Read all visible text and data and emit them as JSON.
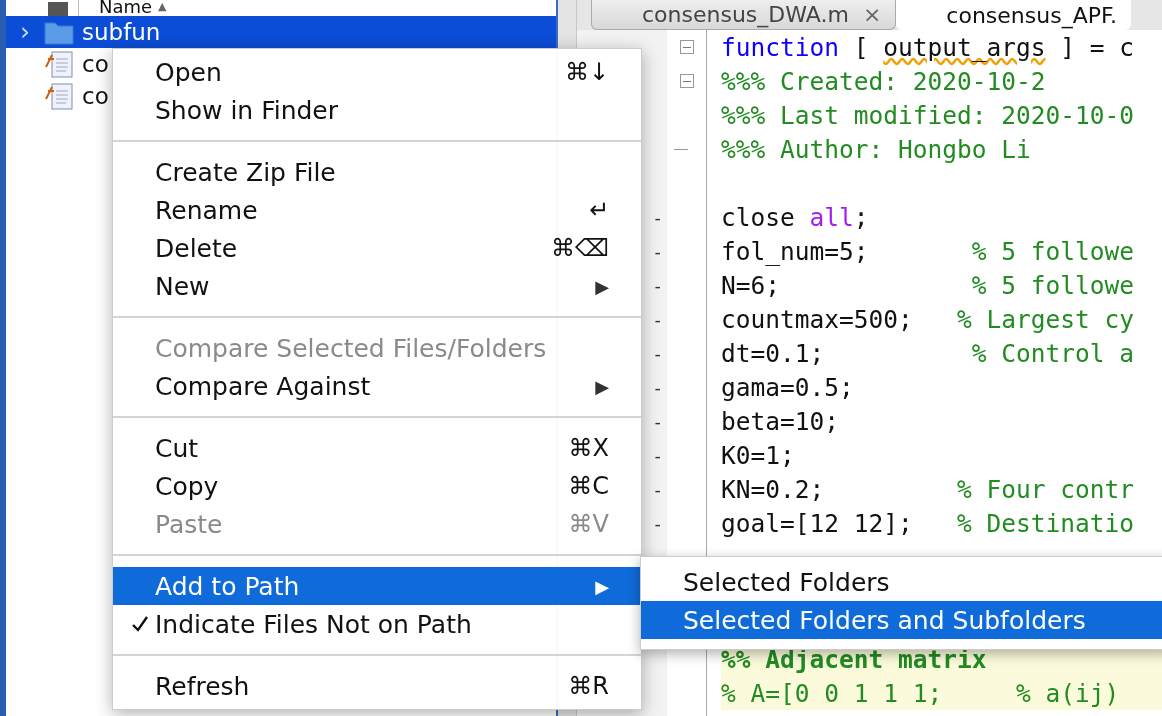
{
  "browser": {
    "header": {
      "label": "Name",
      "sort": "▲"
    },
    "rows": [
      {
        "kind": "folder",
        "name": "subfun",
        "selected": true,
        "expander": "›"
      },
      {
        "kind": "file",
        "name": "co",
        "selected": false
      },
      {
        "kind": "file",
        "name": "co",
        "selected": false
      }
    ]
  },
  "editor": {
    "tabs": [
      {
        "label": "consensus_DWA.m",
        "selected": false,
        "close": "×"
      },
      {
        "label": "consensus_APF.",
        "selected": true
      }
    ],
    "lines": [
      {
        "kind": "code",
        "fold_start": true,
        "fold_end": false,
        "segments": [
          {
            "kind": "keyword",
            "text": "function"
          },
          {
            "kind": "plain",
            "text": " [ "
          },
          {
            "kind": "warning",
            "text": "output_args"
          },
          {
            "kind": "plain",
            "text": " ] = c"
          }
        ]
      },
      {
        "kind": "code",
        "fold_start": true,
        "fold_end": false,
        "segments": [
          {
            "kind": "comment",
            "text": "%%% Created: 2020-10-2"
          }
        ]
      },
      {
        "kind": "code",
        "fold_start": false,
        "fold_end": false,
        "segments": [
          {
            "kind": "comment",
            "text": "%%% Last modified: 2020-10-0"
          }
        ]
      },
      {
        "kind": "code",
        "fold_start": false,
        "fold_end": true,
        "segments": [
          {
            "kind": "comment",
            "text": "%%% Author: Hongbo Li"
          }
        ]
      },
      {
        "kind": "blank"
      },
      {
        "marker": "-",
        "segments": [
          {
            "kind": "plain",
            "text": "close "
          },
          {
            "kind": "variable",
            "text": "all"
          },
          {
            "kind": "plain",
            "text": ";"
          }
        ]
      },
      {
        "marker": "-",
        "segments": [
          {
            "kind": "plain",
            "text": "fol_num=5;       "
          },
          {
            "kind": "comment",
            "text": "% 5 followe"
          }
        ]
      },
      {
        "marker": "-",
        "segments": [
          {
            "kind": "plain",
            "text": "N=6;             "
          },
          {
            "kind": "comment",
            "text": "% 5 followe"
          }
        ]
      },
      {
        "marker": "-",
        "segments": [
          {
            "kind": "plain",
            "text": "countmax=500;   "
          },
          {
            "kind": "comment",
            "text": "% Largest cy"
          }
        ]
      },
      {
        "marker": "-",
        "segments": [
          {
            "kind": "plain",
            "text": "dt=0.1;          "
          },
          {
            "kind": "comment",
            "text": "% Control a"
          }
        ]
      },
      {
        "marker": "-",
        "segments": [
          {
            "kind": "plain",
            "text": "gama=0.5;"
          }
        ]
      },
      {
        "marker": "-",
        "segments": [
          {
            "kind": "plain",
            "text": "beta=10;"
          }
        ]
      },
      {
        "marker": "-",
        "segments": [
          {
            "kind": "plain",
            "text": "K0=1;"
          }
        ]
      },
      {
        "marker": "-",
        "segments": [
          {
            "kind": "plain",
            "text": "KN=0.2;         "
          },
          {
            "kind": "comment",
            "text": "% Four contr"
          }
        ]
      },
      {
        "marker": "-",
        "segments": [
          {
            "kind": "plain",
            "text": "goal=[12 12];   "
          },
          {
            "kind": "comment",
            "text": "% Destinatio"
          }
        ]
      },
      {
        "kind": "blank"
      },
      {
        "kind": "blank"
      },
      {
        "kind": "blank"
      },
      {
        "kind": "cell",
        "segments": [
          {
            "kind": "cell-title",
            "text": "%% Adjacent matrix"
          }
        ]
      },
      {
        "kind": "cell",
        "segments": [
          {
            "kind": "comment",
            "text": "% A=[0 0 1 1 1;     % a(ij)"
          }
        ]
      }
    ]
  },
  "context_menu": {
    "sections": [
      {
        "items": [
          {
            "label": "Open",
            "shortcut": "⌘↓",
            "selected": false,
            "disabled": false,
            "checked": false
          },
          {
            "label": "Show in Finder",
            "selected": false,
            "disabled": false,
            "checked": false
          }
        ]
      },
      {
        "items": [
          {
            "label": "Create Zip File",
            "selected": false,
            "disabled": false,
            "checked": false
          },
          {
            "label": "Rename",
            "shortcut": "↵",
            "selected": false,
            "disabled": false,
            "checked": false
          },
          {
            "label": "Delete",
            "shortcut": "⌘⌫",
            "selected": false,
            "disabled": false,
            "checked": false
          },
          {
            "label": "New",
            "arrow": "▶",
            "selected": false,
            "disabled": false,
            "checked": false
          }
        ]
      },
      {
        "items": [
          {
            "label": "Compare Selected Files/Folders",
            "selected": false,
            "disabled": true,
            "checked": false
          },
          {
            "label": "Compare Against",
            "arrow": "▶",
            "selected": false,
            "disabled": false,
            "checked": false
          }
        ]
      },
      {
        "items": [
          {
            "label": "Cut",
            "shortcut": "⌘X",
            "selected": false,
            "disabled": false,
            "checked": false
          },
          {
            "label": "Copy",
            "shortcut": "⌘C",
            "selected": false,
            "disabled": false,
            "checked": false
          },
          {
            "label": "Paste",
            "shortcut": "⌘V",
            "selected": false,
            "disabled": true,
            "checked": false
          }
        ]
      },
      {
        "items": [
          {
            "label": "Add to Path",
            "arrow": "▶",
            "selected": true,
            "disabled": false,
            "checked": false
          },
          {
            "label": "Indicate Files Not on Path",
            "selected": false,
            "disabled": false,
            "checked": true
          }
        ]
      },
      {
        "items": [
          {
            "label": "Refresh",
            "shortcut": "⌘R",
            "selected": false,
            "disabled": false,
            "checked": false
          }
        ]
      }
    ]
  },
  "submenu": {
    "items": [
      {
        "label": "Selected Folders",
        "selected": false
      },
      {
        "label": "Selected Folders and Subfolders",
        "selected": true
      }
    ]
  }
}
